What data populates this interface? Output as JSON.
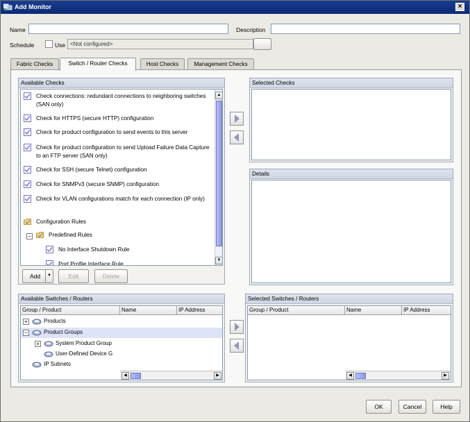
{
  "window": {
    "title": "Add Monitor",
    "close_label": "×"
  },
  "form": {
    "name_label": "Name",
    "name_value": "",
    "description_label": "Description",
    "description_value": "",
    "schedule_label": "Schedule",
    "use_label": "Use",
    "schedule_value": "<Not configured>"
  },
  "tabs": [
    {
      "label": "Fabric Checks",
      "active": false
    },
    {
      "label": "Switch / Router Checks",
      "active": true
    },
    {
      "label": "Host Checks",
      "active": false
    },
    {
      "label": "Management Checks",
      "active": false
    }
  ],
  "available_checks": {
    "title": "Available Checks",
    "items": [
      {
        "label": "Check connections: redundant connections to neighboring switches (SAN only)",
        "icon": "check-rule-icon"
      },
      {
        "label": "Check for HTTPS (secure HTTP) configuration",
        "icon": "check-rule-icon"
      },
      {
        "label": "Check for product configuration to send events to this server",
        "icon": "check-rule-icon"
      },
      {
        "label": "Check for product configuration to send Upload Failure Data Capture to an FTP server (SAN only)",
        "icon": "check-rule-icon"
      },
      {
        "label": "Check for SSH (secure Telnet) configuration",
        "icon": "check-rule-icon"
      },
      {
        "label": "Check for SNMPv3 (secure SNMP) configuration",
        "icon": "check-rule-icon"
      },
      {
        "label": "Check for VLAN configurations match for each connection (IP only)",
        "icon": "check-rule-icon"
      }
    ],
    "tree": [
      {
        "label": "Configuration Rules",
        "icon": "folder-icon"
      },
      {
        "label": "Predefined Rules",
        "icon": "folder-icon",
        "expander": "−"
      },
      {
        "label": "No Interface Shutdown Rule",
        "icon": "check-rule-icon"
      },
      {
        "label": "Port Profile Interface Rule",
        "icon": "check-rule-icon"
      }
    ],
    "add_label": "Add",
    "edit_label": "Edit",
    "delete_label": "Delete"
  },
  "selected_checks": {
    "title": "Selected Checks"
  },
  "details": {
    "title": "Details"
  },
  "available_switches": {
    "title": "Available Switches / Routers",
    "columns": [
      "Group / Product",
      "Name",
      "IP Address"
    ],
    "rows": [
      {
        "label": "Products",
        "expander": "+",
        "selected": false
      },
      {
        "label": "Product Groups",
        "expander": "−",
        "selected": true
      },
      {
        "label": "System Product Group",
        "expander": "+",
        "selected": false
      },
      {
        "label": "User-Defined Device G",
        "expander": "",
        "selected": false
      },
      {
        "label": "IP Subnets",
        "expander": "",
        "selected": false
      }
    ]
  },
  "selected_switches": {
    "title": "Selected Switches / Routers",
    "columns": [
      "Group / Product",
      "Name",
      "IP Address"
    ]
  },
  "footer": {
    "ok_label": "OK",
    "cancel_label": "Cancel",
    "help_label": "Help"
  },
  "colors": {
    "title_bar": "#0b2a74",
    "panel_header": "#cfd6e3",
    "selection": "#dde4f8",
    "scroll_thumb": "#8f98e6"
  }
}
